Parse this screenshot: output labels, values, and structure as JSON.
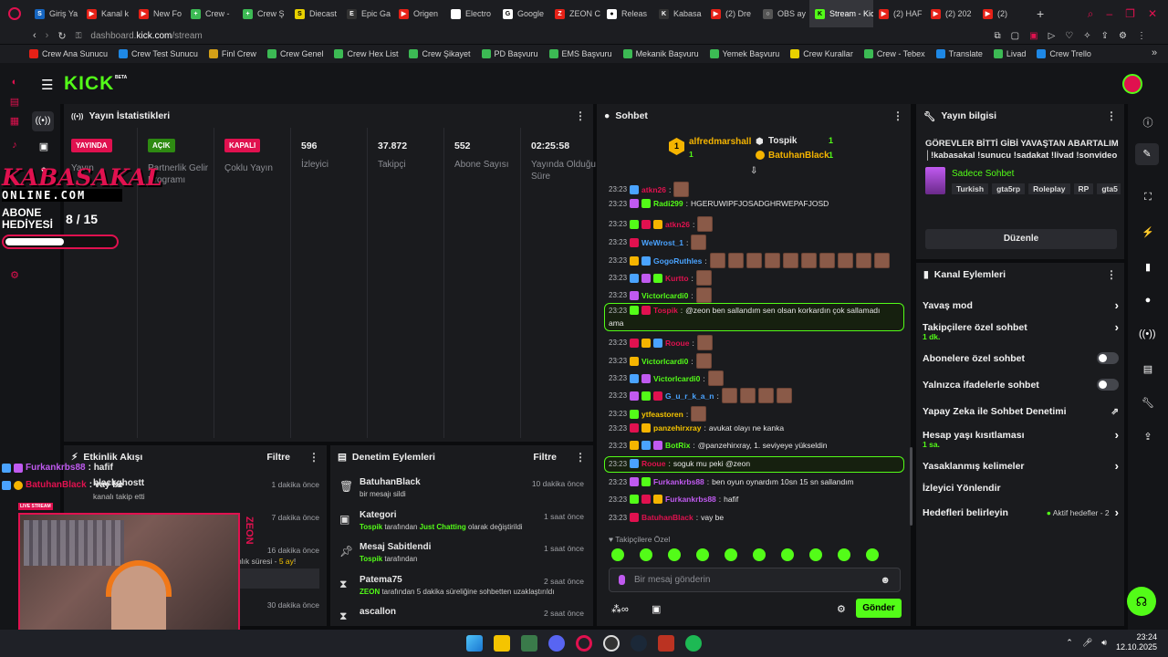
{
  "browser": {
    "tabs": [
      {
        "label": "Giriş Ya",
        "color": "#1565c0",
        "glyph": "S"
      },
      {
        "label": "Kanal k",
        "color": "#e62117",
        "glyph": "▶"
      },
      {
        "label": "New Fo",
        "color": "#e62117",
        "glyph": "▶"
      },
      {
        "label": "Crew - ",
        "color": "#3cba54",
        "glyph": "+"
      },
      {
        "label": "Crew Ş",
        "color": "#3cba54",
        "glyph": "+"
      },
      {
        "label": "Diecast",
        "color": "#e8d100",
        "glyph": "S"
      },
      {
        "label": "Epic Ga",
        "color": "#333333",
        "glyph": "E"
      },
      {
        "label": "Origen",
        "color": "#e62117",
        "glyph": "▶"
      },
      {
        "label": "Electro",
        "color": "#ffffff",
        "glyph": ""
      },
      {
        "label": "Google",
        "color": "#ffffff",
        "glyph": "G"
      },
      {
        "label": "ZEON C",
        "color": "#e62117",
        "glyph": "Z"
      },
      {
        "label": "Releas",
        "color": "#ffffff",
        "glyph": "●"
      },
      {
        "label": "Kabasa",
        "color": "#333333",
        "glyph": "K"
      },
      {
        "label": "(2) Dre",
        "color": "#e62117",
        "glyph": "▶"
      },
      {
        "label": "OBS ay",
        "color": "#555555",
        "glyph": "○"
      },
      {
        "label": "Stream - Kick",
        "color": "#53fc18",
        "glyph": "K"
      },
      {
        "label": "(2) HAF",
        "color": "#e62117",
        "glyph": "▶"
      },
      {
        "label": "(2) 202",
        "color": "#e62117",
        "glyph": "▶"
      },
      {
        "label": "(2)",
        "color": "#e62117",
        "glyph": "▶"
      }
    ],
    "url_prefix": "dashboard.",
    "url_domain": "kick.com",
    "url_path": "/stream",
    "bookmarks": [
      {
        "label": "Crew Ana Sunucu",
        "color": "#e62117"
      },
      {
        "label": "Crew Test Sunucu",
        "color": "#1e88e5"
      },
      {
        "label": "Finl Crew",
        "color": "#d4a017"
      },
      {
        "label": "Crew Genel",
        "color": "#3cba54"
      },
      {
        "label": "Crew Hex List",
        "color": "#3cba54"
      },
      {
        "label": "Crew Şikayet",
        "color": "#3cba54"
      },
      {
        "label": "PD Başvuru",
        "color": "#3cba54"
      },
      {
        "label": "EMS Başvuru",
        "color": "#3cba54"
      },
      {
        "label": "Mekanik Başvuru",
        "color": "#3cba54"
      },
      {
        "label": "Yemek Başvuru",
        "color": "#3cba54"
      },
      {
        "label": "Crew Kurallar",
        "color": "#e8d100"
      },
      {
        "label": "Crew - Tebex",
        "color": "#3cba54"
      },
      {
        "label": "Translate",
        "color": "#1e88e5"
      },
      {
        "label": "Livad",
        "color": "#3cba54"
      },
      {
        "label": "Crew Trello",
        "color": "#1e88e5"
      }
    ]
  },
  "kick": {
    "logo": "KICK",
    "beta": "BETA"
  },
  "stats": {
    "title": "Yayın İstatistikleri",
    "items": [
      {
        "badge": "YAYINDA",
        "badge_color": "#e0114f",
        "label": "Yayın"
      },
      {
        "badge": "AÇIK",
        "badge_color": "#53fc18",
        "label": "Partnerlik Gelir Programı"
      },
      {
        "badge": "KAPALI",
        "badge_color": "#e0114f",
        "label": "Çoklu Yayın"
      },
      {
        "value": "596",
        "label": "İzleyici"
      },
      {
        "value": "37.872",
        "label": "Takipçi"
      },
      {
        "value": "552",
        "label": "Abone Sayısı"
      },
      {
        "value": "02:25:58",
        "label": "Yayında Olduğu Süre"
      }
    ]
  },
  "overlay": {
    "brand1": "KABASAKAL",
    "brand2": "ONLINE.COM",
    "goal_label1": "ABONE",
    "goal_label2": "HEDİYESİ",
    "goal_count": "8 / 15",
    "goal_progress": 0.53
  },
  "activity": {
    "title": "Etkinlik Akışı",
    "filter": "Filtre",
    "items": [
      {
        "user": "blackghostt",
        "action": "kanalı takip etti",
        "time": "1 dakika önce"
      },
      {
        "time": "7 dakika önce"
      },
      {
        "time": "16 dakika önce",
        "text": "nlık süresi - ",
        "highlight": "5 ay",
        "suffix": "!"
      },
      {
        "time": "30 dakika önce"
      }
    ],
    "overlay_chat": [
      {
        "user": "Furkankrbs88",
        "text": " : hafif",
        "color": "#c05af0"
      },
      {
        "user": "BatuhanBlack",
        "text": " : vay be",
        "color": "#e0114f"
      }
    ],
    "cam_brand": "ZEON"
  },
  "moderation": {
    "title": "Denetim Eylemleri",
    "filter": "Filtre",
    "items": [
      {
        "icon": "trash-icon",
        "title": "BatuhanBlack",
        "desc": "bir mesajı sildi",
        "time": "10 dakika önce"
      },
      {
        "icon": "category-icon",
        "title": "Kategori",
        "desc_user": "Tospik",
        "desc_mid": " tarafından ",
        "desc_hl": "Just Chatting",
        "desc_end": " olarak değiştirildi",
        "time": "1 saat önce"
      },
      {
        "icon": "pin-icon",
        "title": "Mesaj Sabitlendi",
        "desc_user": "Tospik",
        "desc_mid": " tarafından",
        "time": "1 saat önce"
      },
      {
        "icon": "hourglass-icon",
        "title": "Patema75",
        "desc_user": "ZEON",
        "desc_mid": " tarafından 5 dakika süreliğine sohbetten uzaklaştırıldı",
        "time": "2 saat önce"
      },
      {
        "icon": "hourglass-icon",
        "title": "ascallon",
        "time": "2 saat önce"
      }
    ]
  },
  "chat": {
    "title": "Sohbet",
    "top_gifters": [
      {
        "name": "alfredmarshall",
        "count": "1",
        "rank": "1",
        "color": "#f5b400"
      },
      {
        "name": "Tospik",
        "count": "1",
        "color": "#e8e8e8"
      },
      {
        "name": "BatuhanBlack",
        "count": "1",
        "color": "#f5b400"
      }
    ],
    "messages": [
      {
        "ts": "23:23",
        "user": "atkn26",
        "color": "#e0114f",
        "text": "",
        "emotes": 1
      },
      {
        "ts": "23:23",
        "user": "Radi299",
        "color": "#53fc18",
        "text": "HGERUWIPFJOSADGHRWEPAFJOSD",
        "emotes": 0
      },
      {
        "ts": "23:23",
        "user": "atkn26",
        "color": "#e0114f",
        "text": "",
        "emotes": 1
      },
      {
        "ts": "23:23",
        "user": "WeWrost_1",
        "color": "#4aa3ff",
        "text": "",
        "emotes": 1
      },
      {
        "ts": "23:23",
        "user": "GogoRuthles",
        "color": "#4aa3ff",
        "text": "",
        "emotes": 10
      },
      {
        "ts": "23:23",
        "user": "Kurtto",
        "color": "#e0114f",
        "text": "",
        "emotes": 1
      },
      {
        "ts": "23:23",
        "user": "Victorlcardi0",
        "color": "#53fc18",
        "text": "",
        "emotes": 1
      },
      {
        "ts": "23:23",
        "user": "Tospik",
        "color": "#e0114f",
        "text": "@zeon ben sallandım sen olsan korkardın çok sallamadı",
        "text2": "ama",
        "emotes": 0,
        "highlight": true
      },
      {
        "ts": "23:23",
        "user": "Rooue",
        "color": "#e0114f",
        "text": "",
        "emotes": 1
      },
      {
        "ts": "23:23",
        "user": "Victorlcardi0",
        "color": "#53fc18",
        "text": "",
        "emotes": 1
      },
      {
        "ts": "23:23",
        "user": "Victorlcardi0",
        "color": "#53fc18",
        "text": "",
        "emotes": 1
      },
      {
        "ts": "23:23",
        "user": "G_u_r_k_a_n",
        "color": "#4aa3ff",
        "text": "",
        "emotes": 4
      },
      {
        "ts": "23:23",
        "user": "ytfeastoren",
        "color": "#f5c400",
        "text": "",
        "emotes": 1
      },
      {
        "ts": "23:23",
        "user": "panzehirxray",
        "color": "#f5c400",
        "text": "avukat olayı ne kanka",
        "emotes": 0
      },
      {
        "ts": "23:23",
        "user": "BotRix",
        "color": "#53fc18",
        "text": "@panzehirxray, 1. seviyeye yükseldin",
        "emotes": 0
      },
      {
        "ts": "23:23",
        "user": "Rooue",
        "color": "#e0114f",
        "text": "soguk mu peki @zeon",
        "emotes": 0,
        "highlight": true
      },
      {
        "ts": "23:23",
        "user": "Furkankrbs88",
        "color": "#c05af0",
        "text": "ben oyun oynardım 10sn 15 sn sallandım",
        "emotes": 0
      },
      {
        "ts": "23:23",
        "user": "Furkankrbs88",
        "color": "#c05af0",
        "text": "hafif",
        "emotes": 0
      },
      {
        "ts": "23:23",
        "user": "BatuhanBlack",
        "color": "#e0114f",
        "text": "vay be",
        "emotes": 0
      }
    ],
    "emote_label": "Takipçilere Özel",
    "input_placeholder": "Bir mesaj gönderin",
    "send_label": "Gönder"
  },
  "stream_info": {
    "title": "Yayın bilgisi",
    "text": "GÖREVLER BİTTİ GİBİ YAVAŞTAN ABARTALIM │!kabasakal !sunucu !sadakat !livad !sonvideo",
    "mode": "Sadece Sohbet",
    "tags": [
      "Turkish",
      "gta5rp",
      "Roleplay",
      "RP",
      "gta5"
    ],
    "edit": "Düzenle"
  },
  "channel_actions": {
    "title": "Kanal Eylemleri",
    "items": [
      {
        "label": "Yavaş mod",
        "kind": "chevron"
      },
      {
        "label": "Takipçilere özel sohbet",
        "sub": "1 dk.",
        "kind": "chevron"
      },
      {
        "label": "Abonelere özel sohbet",
        "kind": "toggle"
      },
      {
        "label": "Yalnızca ifadelerle sohbet",
        "kind": "toggle"
      },
      {
        "label": "Yapay Zeka ile Sohbet Denetimi",
        "kind": "external"
      },
      {
        "label": "Hesap yaşı kısıtlaması",
        "sub": "1 sa.",
        "kind": "chevron"
      },
      {
        "label": "Yasaklanmış kelimeler",
        "kind": "chevron"
      },
      {
        "label": "İzleyici Yönlendir",
        "kind": "none"
      },
      {
        "label": "Hedefleri belirleyin",
        "note": "Aktif hedefler - 2",
        "kind": "chevron"
      }
    ]
  },
  "taskbar": {
    "time": "23:24",
    "date": "12.10.2025"
  },
  "colors": {
    "kick_green": "#53fc18",
    "live_red": "#e0114f"
  }
}
